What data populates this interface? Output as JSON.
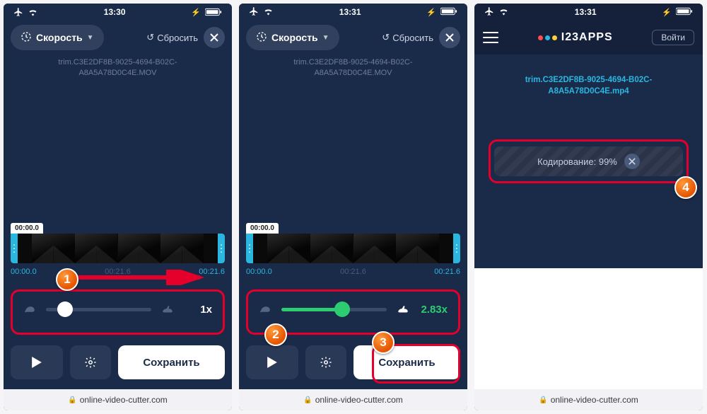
{
  "status_bar": {
    "time1": "13:30",
    "time2": "13:31",
    "time3": "13:31"
  },
  "toolbar": {
    "speed_label": "Скорость",
    "reset_label": "Сбросить"
  },
  "filename": {
    "line1": "trim.C3E2DF8B-9025-4694-B02C-",
    "line2": "A8A5A78D0C4E.MOV"
  },
  "filename_mp4": {
    "line1": "trim.C3E2DF8B-9025-4694-B02C-",
    "line2": "A8A5A78D0C4E.mp4"
  },
  "timeline": {
    "start_label": "00:00.0",
    "left": "00:00.0",
    "mid": "00:21.6",
    "right": "00:21.6"
  },
  "slider": {
    "value1": "1x",
    "value2": "2.83x"
  },
  "buttons": {
    "save": "Сохранить"
  },
  "url": "online-video-cutter.com",
  "apps_header": {
    "logo_main": "I23APPS",
    "login": "Войти"
  },
  "encoding": {
    "label": "Кодирование:",
    "value": "99%"
  },
  "badges": {
    "b1": "1",
    "b2": "2",
    "b3": "3",
    "b4": "4"
  }
}
